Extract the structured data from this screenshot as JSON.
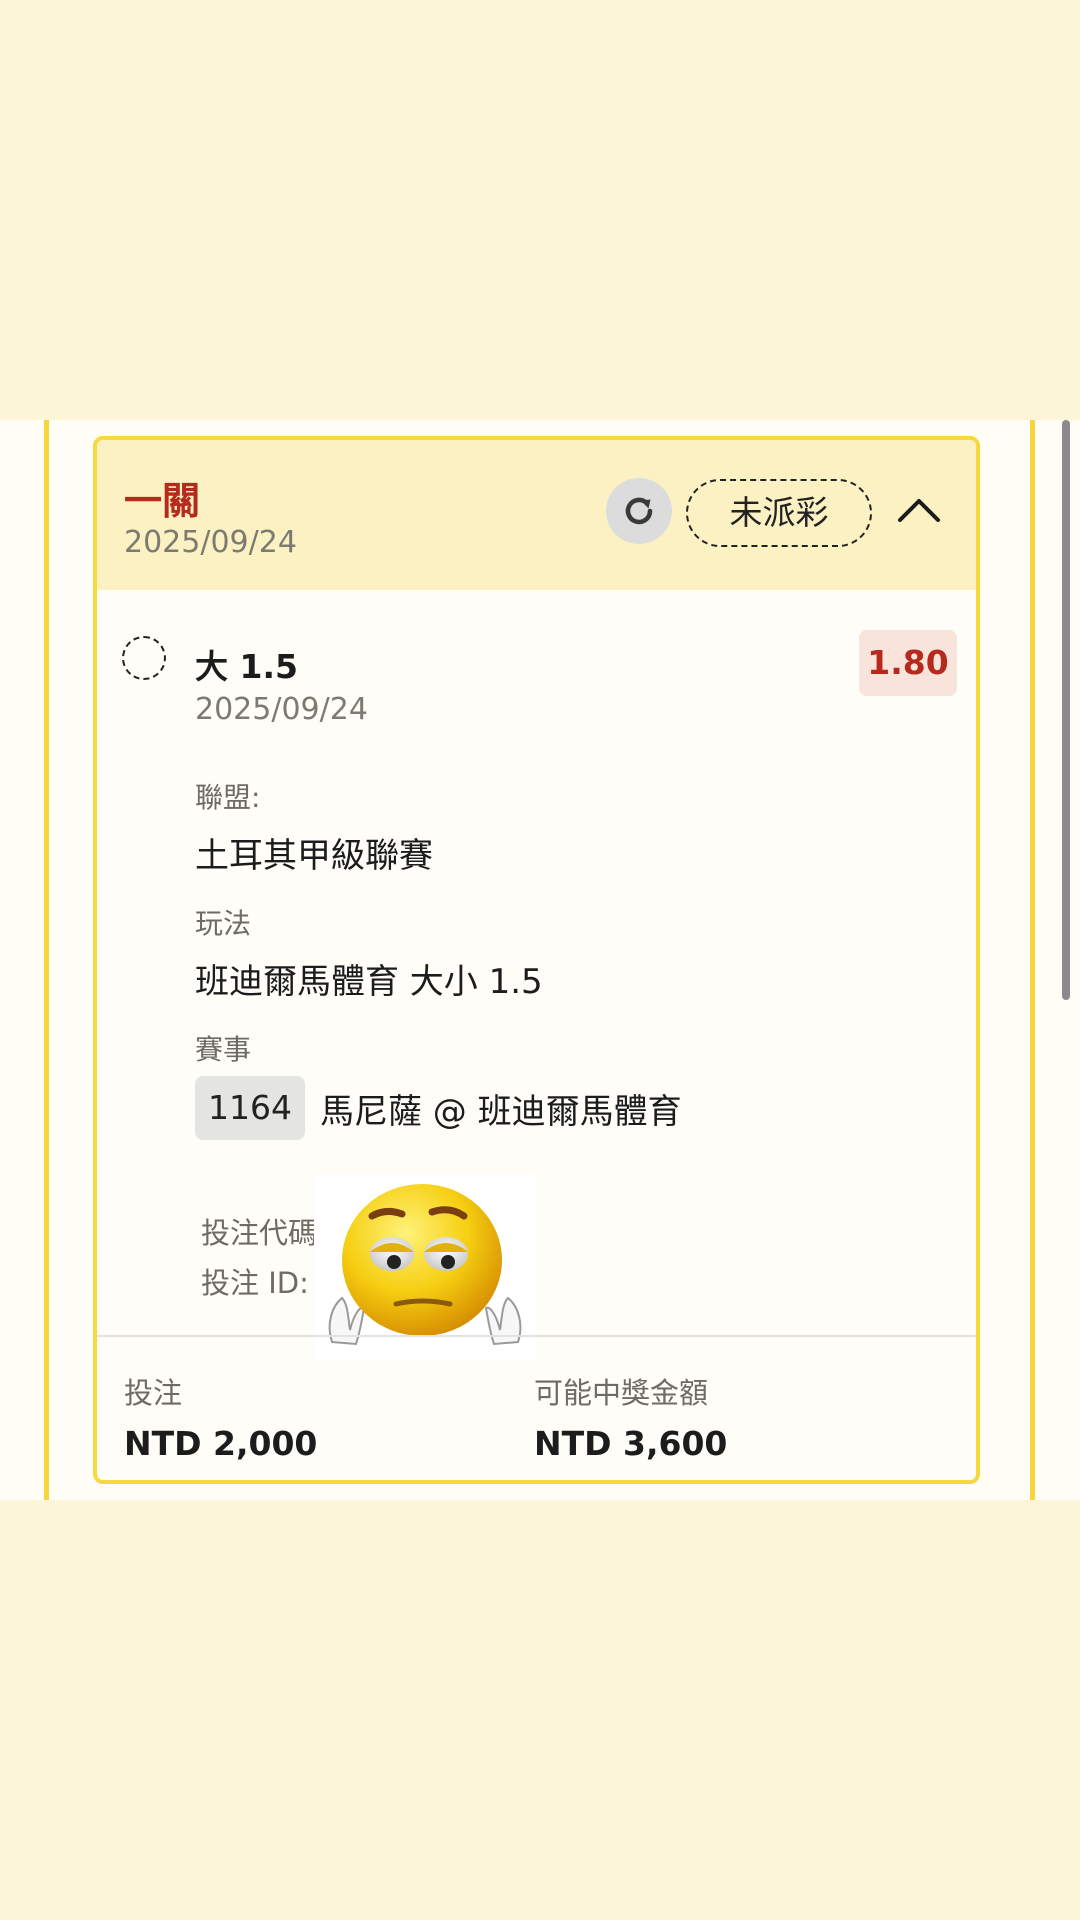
{
  "bet": {
    "type_label": "一關",
    "date": "2025/09/24",
    "status": "未派彩",
    "selection": {
      "name": "大 1.5",
      "date": "2025/09/24",
      "odds": "1.80"
    },
    "league": {
      "label": "聯盟:",
      "value": "土耳其甲級聯賽"
    },
    "market": {
      "label": "玩法",
      "value": "班迪爾馬體育 大小 1.5"
    },
    "event": {
      "label": "賽事",
      "match_id": "1164",
      "teams": "馬尼薩 @ 班迪爾馬體育"
    },
    "code_label": "投注代碼",
    "id_label": "投注 ID:",
    "footer": {
      "stake_label": "投注",
      "stake_value": "NTD 2,000",
      "payout_label": "可能中獎金額",
      "payout_value": "NTD 3,600"
    }
  },
  "icons": {
    "refresh": "refresh-icon",
    "collapse": "chevron-up-icon",
    "pending": "pending-circle-icon",
    "sticker": "sad-emoji-sticker"
  },
  "colors": {
    "accent_red": "#b52a1c",
    "card_border": "#f5d93e",
    "header_bg": "#fcf1c2",
    "page_bg": "#fcf5d6"
  }
}
